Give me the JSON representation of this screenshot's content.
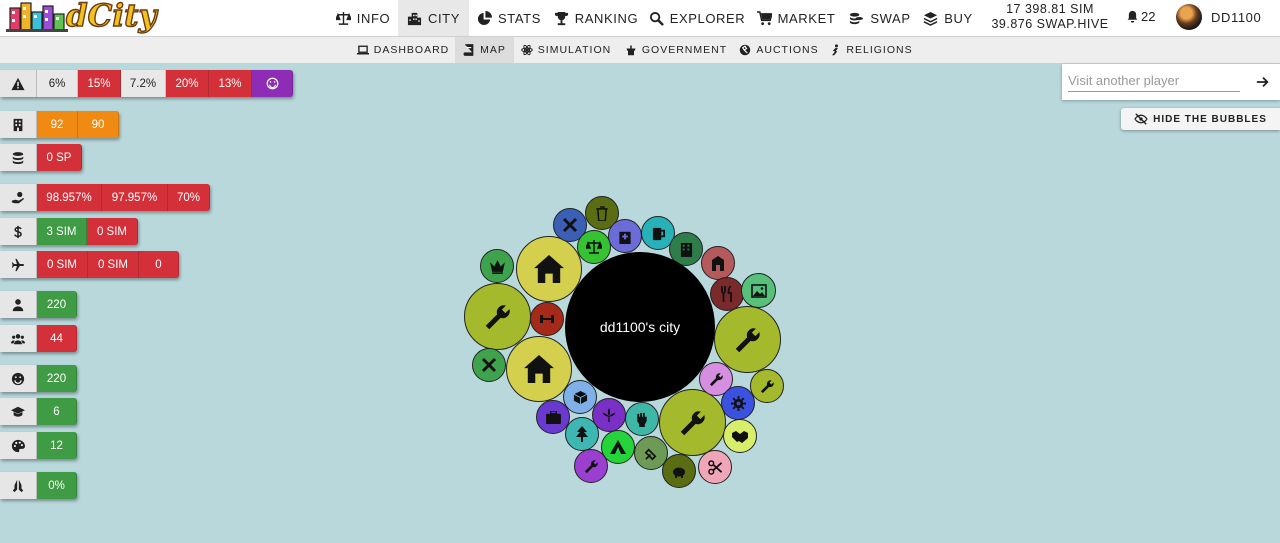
{
  "header": {
    "brand": "dCity",
    "nav": [
      {
        "label": "INFO",
        "icon": "scales-icon"
      },
      {
        "label": "CITY",
        "icon": "city-icon"
      },
      {
        "label": "STATS",
        "icon": "pie-chart-icon"
      },
      {
        "label": "RANKING",
        "icon": "trophy-icon"
      },
      {
        "label": "EXPLORER",
        "icon": "search-icon"
      },
      {
        "label": "MARKET",
        "icon": "cart-icon"
      },
      {
        "label": "SWAP",
        "icon": "coins-icon"
      },
      {
        "label": "BUY",
        "icon": "layers-icon"
      }
    ],
    "balance_sim": "17 398.81 SIM",
    "balance_swap": "39.876 SWAP.HIVE",
    "notifications": "22",
    "username": "DD1100"
  },
  "subnav": [
    {
      "label": "DASHBOARD",
      "icon": "laptop-icon"
    },
    {
      "label": "MAP",
      "icon": "book-icon"
    },
    {
      "label": "SIMULATION",
      "icon": "atom-icon"
    },
    {
      "label": "GOVERNMENT",
      "icon": "podium-icon"
    },
    {
      "label": "AUCTIONS",
      "icon": "gavel-icon"
    },
    {
      "label": "RELIGIONS",
      "icon": "praying-icon"
    }
  ],
  "stats": {
    "risk": [
      "6%",
      "15%",
      "7.2%",
      "20%",
      "13%"
    ],
    "buildings": [
      "92",
      "90"
    ],
    "sp": [
      "0 SP"
    ],
    "income": [
      "98.957%",
      "97.957%",
      "70%"
    ],
    "money": [
      "3 SIM",
      "0 SIM"
    ],
    "travel": [
      "0 SIM",
      "0 SIM",
      "0"
    ],
    "population": [
      "220"
    ],
    "workers": [
      "44"
    ],
    "happiness": [
      "220"
    ],
    "education": [
      "6"
    ],
    "culture": [
      "12"
    ],
    "religion": [
      "0%"
    ]
  },
  "visit": {
    "placeholder": "Visit another player"
  },
  "hide_bubbles_label": "HIDE THE BUBBLES",
  "city_label": "dd1100's city",
  "colors": {
    "red": "#d3303a",
    "orange": "#f18a12",
    "green": "#3f9b44",
    "purple": "#8e2cb5",
    "background": "#b9d8dc",
    "olive": "#a4ba2c",
    "yellow": "#d4d04e"
  }
}
